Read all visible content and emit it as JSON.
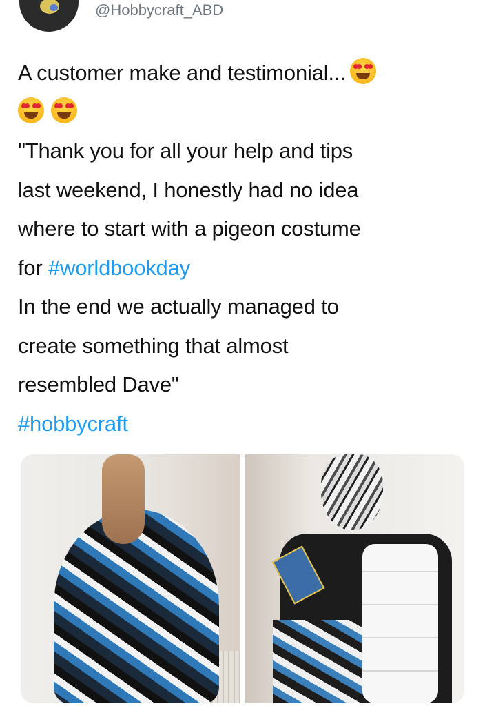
{
  "author": {
    "handle": "@Hobbycraft_ABD"
  },
  "tweet": {
    "lines": [
      "A customer make and testimonial...",
      "",
      "\"Thank you for all your help and tips",
      "last weekend, I honestly had no idea",
      "where to start with a pigeon costume",
      "for ",
      "In the end we actually managed to",
      "create something that almost",
      "resembled Dave\""
    ],
    "hashtag_1": "#worldbookday",
    "hashtag_2": "#hobbycraft",
    "emojis": [
      "heart-eyes-emoji",
      "heart-eyes-emoji",
      "heart-eyes-emoji"
    ]
  },
  "media": {
    "count": 2,
    "items": [
      "pigeon-costume-back-photo",
      "pigeon-costume-front-photo"
    ]
  },
  "colors": {
    "hashtag": "#1d9bf0",
    "handle": "#6e7781",
    "text": "#111111"
  }
}
